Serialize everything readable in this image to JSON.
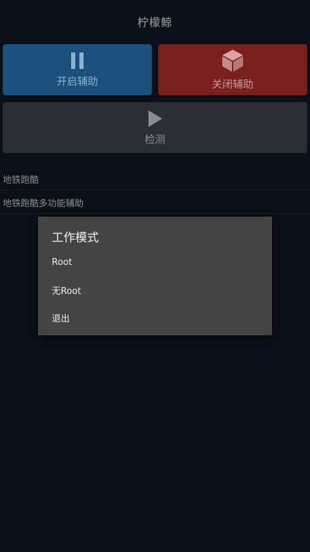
{
  "app": {
    "title": "柠檬鲸"
  },
  "buttons": {
    "start_label": "开启辅助",
    "stop_label": "关闭辅助",
    "detect_label": "检测"
  },
  "icons": {
    "start": "pause-icon",
    "stop": "cube-icon",
    "detect": "play-icon"
  },
  "list": {
    "items": [
      {
        "label": "地铁跑酷"
      },
      {
        "label": "地铁跑酷多功能辅助"
      }
    ]
  },
  "dialog": {
    "title": "工作模式",
    "options": [
      {
        "label": "Root"
      },
      {
        "label": "无Root"
      },
      {
        "label": "退出"
      }
    ]
  },
  "colors": {
    "background": "#0b1018",
    "start_button": "#1c4f7c",
    "stop_button": "#7a1f1f",
    "detect_button": "#2b2f35",
    "dialog": "#444444"
  }
}
